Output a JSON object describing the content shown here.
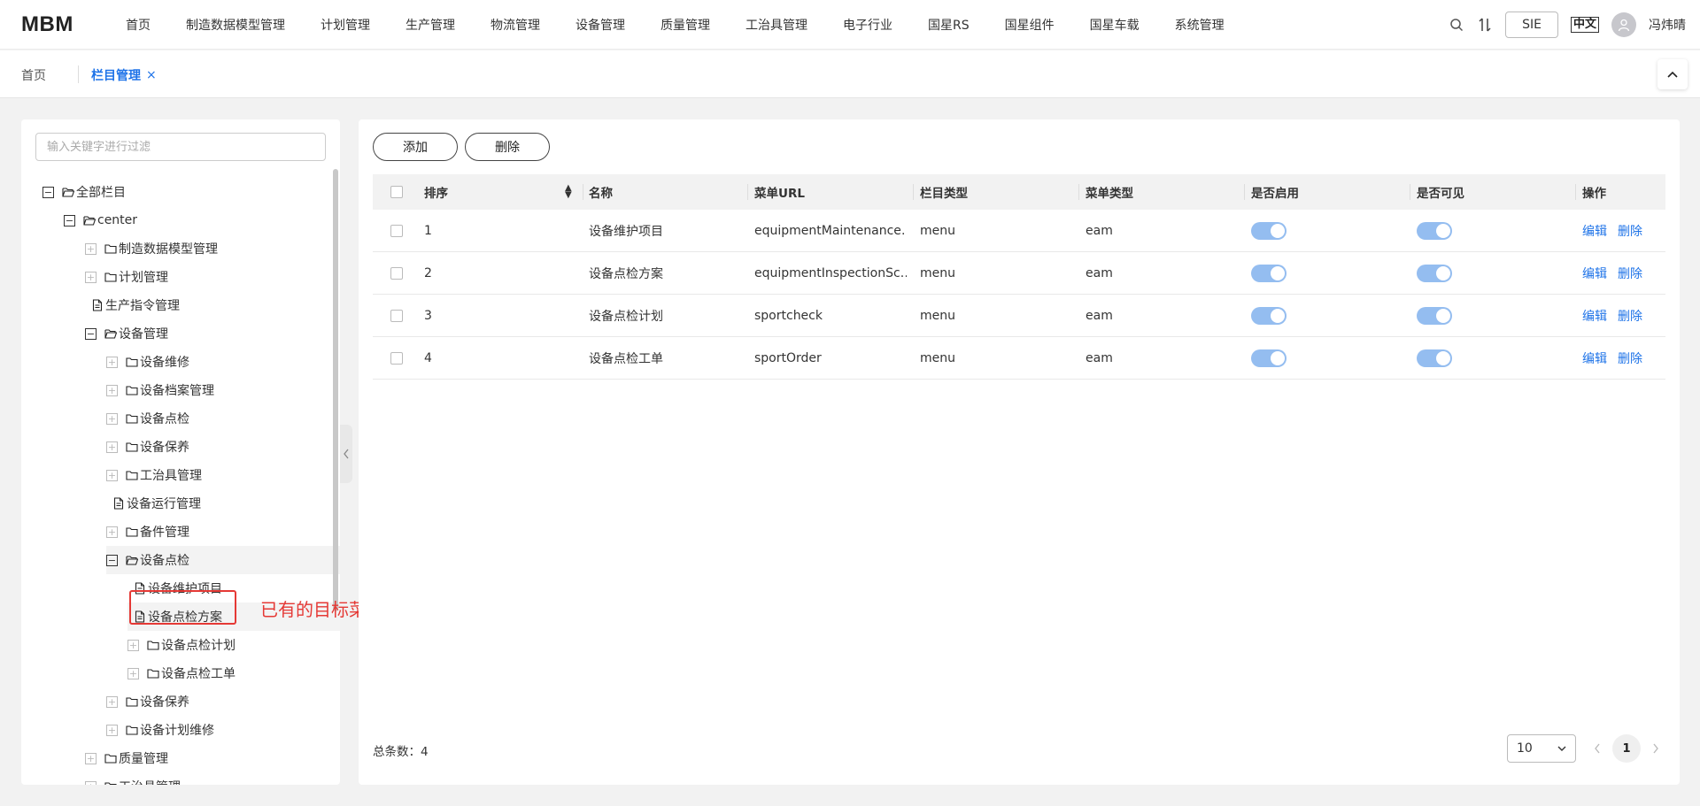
{
  "app": {
    "logo": "MBM"
  },
  "nav": [
    "首页",
    "制造数据模型管理",
    "计划管理",
    "生产管理",
    "物流管理",
    "设备管理",
    "质量管理",
    "工治具管理",
    "电子行业",
    "国星RS",
    "国星组件",
    "国星车载",
    "系统管理"
  ],
  "header": {
    "sie_label": "SIE",
    "lang_label": "中文",
    "username": "冯炜晴"
  },
  "tabs": {
    "home": "首页",
    "active": "栏目管理",
    "close_glyph": "×"
  },
  "filter": {
    "placeholder": "输入关键字进行过滤",
    "value": ""
  },
  "tree": [
    {
      "label": "全部栏目",
      "level": 0,
      "toggle": "minus",
      "icon": "folder-open"
    },
    {
      "label": "center",
      "level": 1,
      "toggle": "minus",
      "icon": "folder-open"
    },
    {
      "label": "制造数据模型管理",
      "level": 2,
      "toggle": "plus",
      "icon": "folder"
    },
    {
      "label": "计划管理",
      "level": 2,
      "toggle": "plus",
      "icon": "folder"
    },
    {
      "label": "生产指令管理",
      "level": 2,
      "toggle": "none",
      "icon": "document"
    },
    {
      "label": "设备管理",
      "level": 2,
      "toggle": "minus",
      "icon": "folder-open"
    },
    {
      "label": "设备维修",
      "level": 3,
      "toggle": "plus",
      "icon": "folder"
    },
    {
      "label": "设备档案管理",
      "level": 3,
      "toggle": "plus",
      "icon": "folder"
    },
    {
      "label": "设备点检",
      "level": 3,
      "toggle": "plus",
      "icon": "folder"
    },
    {
      "label": "设备保养",
      "level": 3,
      "toggle": "plus",
      "icon": "folder"
    },
    {
      "label": "工治具管理",
      "level": 3,
      "toggle": "plus",
      "icon": "folder"
    },
    {
      "label": "设备运行管理",
      "level": 3,
      "toggle": "none",
      "icon": "document"
    },
    {
      "label": "备件管理",
      "level": 3,
      "toggle": "plus",
      "icon": "folder"
    },
    {
      "label": "设备点检",
      "level": 3,
      "toggle": "minus",
      "icon": "folder-open",
      "highlight": true
    },
    {
      "label": "设备维护项目",
      "level": 4,
      "toggle": "none",
      "icon": "document"
    },
    {
      "label": "设备点检方案",
      "level": 4,
      "toggle": "none",
      "icon": "document",
      "highlight": true
    },
    {
      "label": "设备点检计划",
      "level": 4,
      "toggle": "plus",
      "icon": "folder"
    },
    {
      "label": "设备点检工单",
      "level": 4,
      "toggle": "plus",
      "icon": "folder"
    },
    {
      "label": "设备保养",
      "level": 3,
      "toggle": "plus",
      "icon": "folder"
    },
    {
      "label": "设备计划维修",
      "level": 3,
      "toggle": "plus",
      "icon": "folder"
    },
    {
      "label": "质量管理",
      "level": 2,
      "toggle": "plus",
      "icon": "folder"
    },
    {
      "label": "工治具管理",
      "level": 2,
      "toggle": "plus",
      "icon": "folder"
    }
  ],
  "annotation": {
    "text": "已有的目标菜单",
    "color": "#e53935"
  },
  "toolbar": {
    "add_label": "添加",
    "delete_label": "删除"
  },
  "table": {
    "headers": [
      "排序",
      "名称",
      "菜单URL",
      "栏目类型",
      "菜单类型",
      "是否启用",
      "是否可见",
      "操作"
    ],
    "rows": [
      {
        "order": "1",
        "name": "设备维护项目",
        "url": "equipmentMaintenance…",
        "column_type": "menu",
        "menu_type": "eam",
        "enabled": true,
        "visible": true
      },
      {
        "order": "2",
        "name": "设备点检方案",
        "url": "equipmentInspectionSc…",
        "column_type": "menu",
        "menu_type": "eam",
        "enabled": true,
        "visible": true
      },
      {
        "order": "3",
        "name": "设备点检计划",
        "url": "sportcheck",
        "column_type": "menu",
        "menu_type": "eam",
        "enabled": true,
        "visible": true
      },
      {
        "order": "4",
        "name": "设备点检工单",
        "url": "sportOrder",
        "column_type": "menu",
        "menu_type": "eam",
        "enabled": true,
        "visible": true
      }
    ],
    "actions": {
      "edit": "编辑",
      "delete": "删除"
    }
  },
  "pagination": {
    "total_text": "总条数：4",
    "page_size": "10",
    "current_page": "1"
  },
  "colors": {
    "accent": "#1e73e8",
    "switch_on": "#94bdf0",
    "annotation": "#e53935"
  }
}
